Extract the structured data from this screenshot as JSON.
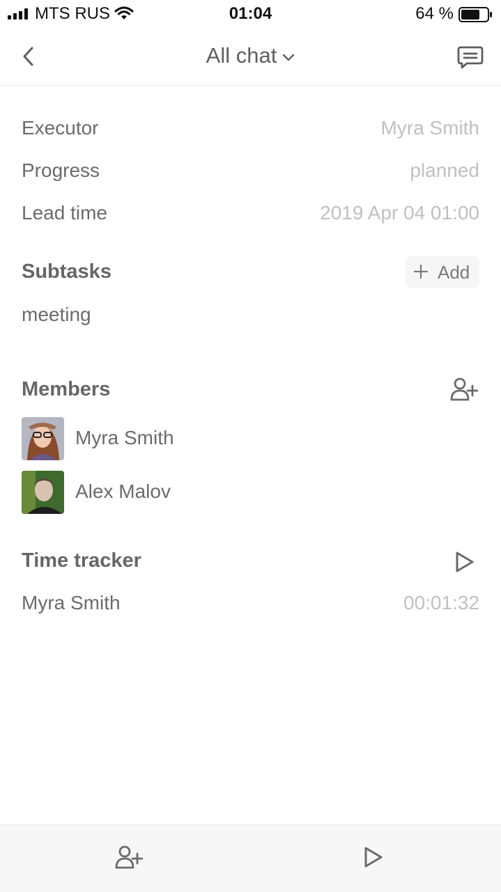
{
  "status_bar": {
    "carrier": "MTS RUS",
    "time": "01:04",
    "battery": "64 %"
  },
  "nav": {
    "title": "All chat",
    "icons": {
      "back": "chevron-left-icon",
      "dropdown": "chevron-down-icon",
      "chat": "chat-bubble-icon"
    }
  },
  "details": {
    "executor": {
      "label": "Executor",
      "value": "Myra Smith"
    },
    "progress": {
      "label": "Progress",
      "value": "planned"
    },
    "lead_time": {
      "label": "Lead time",
      "value": "2019 Apr 04 01:00"
    }
  },
  "subtasks": {
    "title": "Subtasks",
    "add_label": "Add",
    "items": [
      "meeting"
    ]
  },
  "members": {
    "title": "Members",
    "items": [
      {
        "name": "Myra Smith"
      },
      {
        "name": "Alex Malov"
      }
    ]
  },
  "time_tracker": {
    "title": "Time tracker",
    "entries": [
      {
        "name": "Myra Smith",
        "duration": "00:01:32"
      }
    ]
  },
  "colors": {
    "text": "#6b6b6b",
    "muted_value": "#c0c0c0",
    "icon": "#6a6a6a",
    "bottom_bar": "#f7f7f7"
  }
}
